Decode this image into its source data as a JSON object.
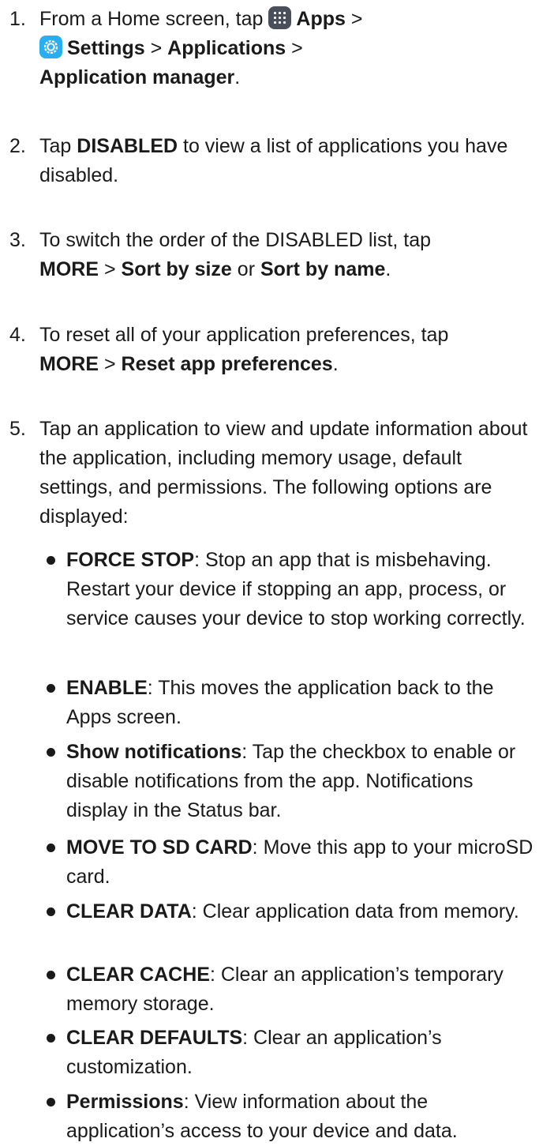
{
  "steps": [
    {
      "number": "1.",
      "pre": "From a Home screen, tap",
      "apps_label": "Apps",
      "sep1": ">",
      "settings_label": "Settings",
      "sep2": ">",
      "applications_label": "Applications",
      "sep3": ">",
      "app_manager_label": "Application manager",
      "end": "."
    },
    {
      "number": "2.",
      "pre": "Tap",
      "bold1": "DISABLED",
      "post": "to view a list of applications you have disabled."
    },
    {
      "number": "3.",
      "pre": "To switch the order of the DISABLED list, tap",
      "bold1": "MORE",
      "sep1": ">",
      "bold2": "Sort by size",
      "mid": "or",
      "bold3": "Sort by name",
      "end": "."
    },
    {
      "number": "4.",
      "pre": "To reset all of your application preferences, tap",
      "bold1": "MORE",
      "sep1": ">",
      "bold2": "Reset app preferences",
      "end": "."
    },
    {
      "number": "5.",
      "text": "Tap an application to view and update information about the application, including memory usage, default settings, and permissions. The following options are displayed:"
    }
  ],
  "bullets": [
    {
      "term": "FORCE STOP",
      "desc": ": Stop an app that is misbehaving. Restart your device if stopping an app, process, or service causes your device to stop working correctly."
    },
    {
      "term": "ENABLE",
      "desc": ": This moves the application back to the Apps screen."
    },
    {
      "term": "Show notifications",
      "desc": ": Tap the checkbox to enable or disable notifications from the app. Notifications display in the Status bar."
    },
    {
      "term": "MOVE TO SD CARD",
      "desc": ": Move this app to your microSD card."
    },
    {
      "term": "CLEAR DATA",
      "desc": ": Clear application data from memory."
    },
    {
      "term": "CLEAR CACHE",
      "desc": ": Clear an application’s temporary memory storage."
    },
    {
      "term": "CLEAR DEFAULTS",
      "desc": ": Clear an application’s customization."
    },
    {
      "term": "Permissions",
      "desc": ": View information about the application’s access to your device and data."
    }
  ],
  "icons": {
    "apps": "apps-grid-icon",
    "settings": "settings-gear-icon",
    "apps_color": "#4b4f5c",
    "settings_color": "#29aef2"
  }
}
